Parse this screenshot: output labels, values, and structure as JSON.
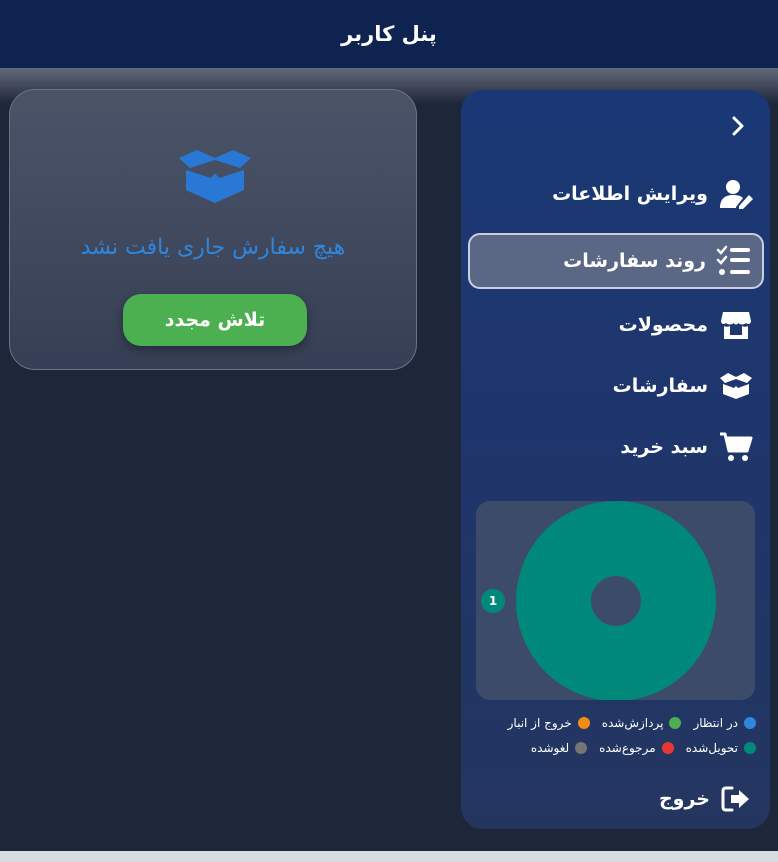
{
  "header": {
    "title": "پنل کاربر"
  },
  "sidebar": {
    "collapse_glyph": "›",
    "items": [
      {
        "label": "ویرایش اطلاعات",
        "icon": "user-edit-icon",
        "active": false
      },
      {
        "label": "روند سفارشات",
        "icon": "checklist-icon",
        "active": true
      },
      {
        "label": "محصولات",
        "icon": "store-icon",
        "active": false
      },
      {
        "label": "سفارشات",
        "icon": "box-open-icon",
        "active": false
      },
      {
        "label": "سبد خرید",
        "icon": "cart-icon",
        "active": false
      }
    ],
    "logout_label": "خروج"
  },
  "main": {
    "empty_message": "هیچ سفارش جاری یافت نشد",
    "retry_label": "تلاش مجدد"
  },
  "chart_data": {
    "type": "pie",
    "donut": true,
    "categories": [
      "در انتظار",
      "پردازش‌شده",
      "خروج از انبار",
      "تحویل‌شده",
      "مرجوع‌شده",
      "لغوشده"
    ],
    "values": [
      0,
      0,
      0,
      1,
      0,
      0
    ],
    "colors": [
      "#2f86de",
      "#4cb051",
      "#f28c13",
      "#00897b",
      "#e53935",
      "#757575"
    ],
    "data_label": "1",
    "legend_position": "bottom"
  },
  "colors": {
    "accent": "#2f86de",
    "success": "#4cb051",
    "header": "#0e2350"
  }
}
